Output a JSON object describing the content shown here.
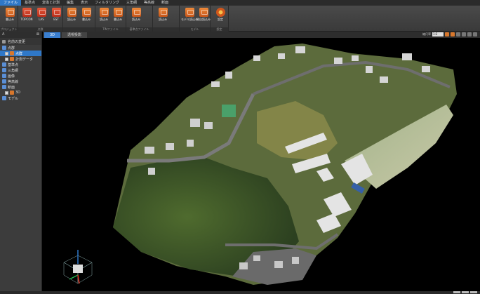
{
  "menu": [
    {
      "label": "ファイル",
      "active": true
    },
    {
      "label": "基準点",
      "active": false
    },
    {
      "label": "変換と計測",
      "active": false
    },
    {
      "label": "編集",
      "active": false
    },
    {
      "label": "表示",
      "active": false
    },
    {
      "label": "フィルタリング",
      "active": false
    },
    {
      "label": "三角網",
      "active": false
    },
    {
      "label": "等高線",
      "active": false
    },
    {
      "label": "断面",
      "active": false
    }
  ],
  "ribbon": {
    "groups": [
      "プロジェクト",
      "点群",
      "TINファイル",
      "基準点ファイル",
      "モデル",
      "設定"
    ],
    "buttons": [
      {
        "label": "書込み",
        "icon": "project-icon",
        "color": "orange"
      },
      {
        "label": "TOPCON",
        "icon": "topcon-icon",
        "color": "red"
      },
      {
        "label": "LAS",
        "icon": "las-icon",
        "color": "red"
      },
      {
        "label": "EST",
        "icon": "est-icon",
        "color": "red"
      },
      {
        "label": "読込み",
        "icon": "read-pointcloud-icon",
        "color": "orange"
      },
      {
        "label": "書込み",
        "icon": "write-pointcloud-icon",
        "color": "orange"
      },
      {
        "label": "読込み",
        "icon": "read-tin-icon",
        "color": "orange"
      },
      {
        "label": "書込み",
        "icon": "write-tin-icon",
        "color": "orange"
      },
      {
        "label": "読込み",
        "icon": "read-control-point-icon",
        "color": "orange"
      },
      {
        "label": "読込み",
        "icon": "read-model-icon",
        "color": "orange"
      },
      {
        "label": "モデル読込み",
        "icon": "model-icon",
        "color": "orange"
      },
      {
        "label": "独自読込み",
        "icon": "custom-read-icon",
        "color": "orange"
      },
      {
        "label": "設定",
        "icon": "gear-icon",
        "color": "gear"
      }
    ]
  },
  "left_panel": {
    "header": "A",
    "toolbar_label": "名前の変更",
    "tree": [
      {
        "label": "点群",
        "level": 0,
        "checkbox": false,
        "selected": false,
        "color": "#5a8fd6"
      },
      {
        "label": "点群",
        "level": 1,
        "checkbox": true,
        "selected": true,
        "color": "#d8772c"
      },
      {
        "label": "計測データ",
        "level": 1,
        "checkbox": true,
        "selected": false,
        "color": "#d8772c"
      },
      {
        "label": "基準点",
        "level": 0,
        "checkbox": false,
        "selected": false,
        "color": "#5a8fd6"
      },
      {
        "label": "三角網",
        "level": 0,
        "checkbox": false,
        "selected": false,
        "color": "#5a8fd6"
      },
      {
        "label": "画像",
        "level": 0,
        "checkbox": false,
        "selected": false,
        "color": "#5a8fd6"
      },
      {
        "label": "等高線",
        "level": 0,
        "checkbox": false,
        "selected": false,
        "color": "#5a8fd6"
      },
      {
        "label": "断面",
        "level": 0,
        "checkbox": false,
        "selected": false,
        "color": "#5a8fd6"
      },
      {
        "label": "3D",
        "level": 1,
        "checkbox": true,
        "selected": false,
        "color": "#d8772c"
      },
      {
        "label": "モデル",
        "level": 0,
        "checkbox": false,
        "selected": false,
        "color": "#5a8fd6"
      }
    ]
  },
  "view": {
    "tabs": [
      {
        "label": "3D",
        "active": true
      },
      {
        "label": "透視投影",
        "active": false
      }
    ],
    "controls_label": "縮尺率",
    "zoom_value": "1:2"
  },
  "colors": {
    "accent": "#2f78c8",
    "vegetation_dark": "#3d5a2a",
    "vegetation_light": "#7a8b4a",
    "roof_white": "#d9d9d9",
    "road": "#6e6e6e"
  }
}
